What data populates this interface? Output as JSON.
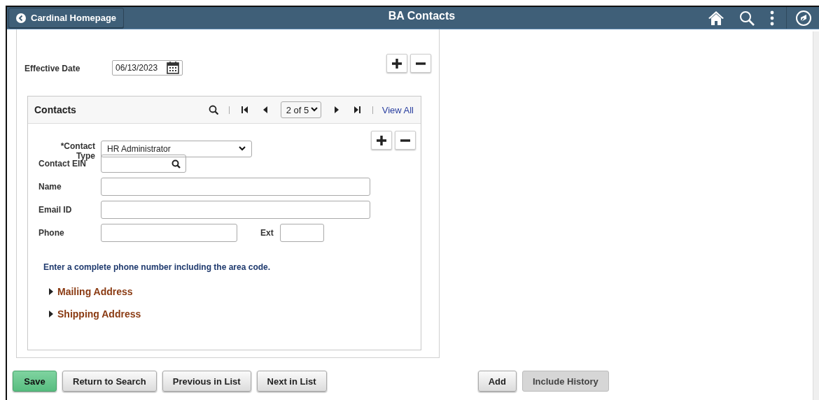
{
  "header": {
    "back_button": "Cardinal Homepage",
    "title": "BA Contacts"
  },
  "effective_date": {
    "label": "Effective Date",
    "value": "06/13/2023"
  },
  "contacts": {
    "title": "Contacts",
    "page_select": "2 of 5",
    "view_all": "View All",
    "fields": [
      {
        "kind": "select",
        "label": "*Contact Type",
        "value": "HR Administrator"
      },
      {
        "kind": "lookup",
        "label": "Contact EIN"
      },
      {
        "kind": "text",
        "label": "Name"
      },
      {
        "kind": "text",
        "label": "Email ID"
      },
      {
        "kind": "phone",
        "label": "Phone",
        "ext_label": "Ext"
      }
    ],
    "hint": "Enter a complete phone number including the area code.",
    "sections": [
      {
        "label": "Mailing Address",
        "expanded": false
      },
      {
        "label": "Shipping Address",
        "expanded": false
      }
    ]
  },
  "buttons": [
    {
      "label": "Save",
      "kind": "primary"
    },
    {
      "label": "Return to Search",
      "kind": "default"
    },
    {
      "label": "Previous in List",
      "kind": "default"
    },
    {
      "label": "Next in List",
      "kind": "default"
    }
  ],
  "side_buttons": [
    {
      "label": "Add",
      "kind": "default"
    },
    {
      "label": "Include History",
      "kind": "muted"
    }
  ]
}
